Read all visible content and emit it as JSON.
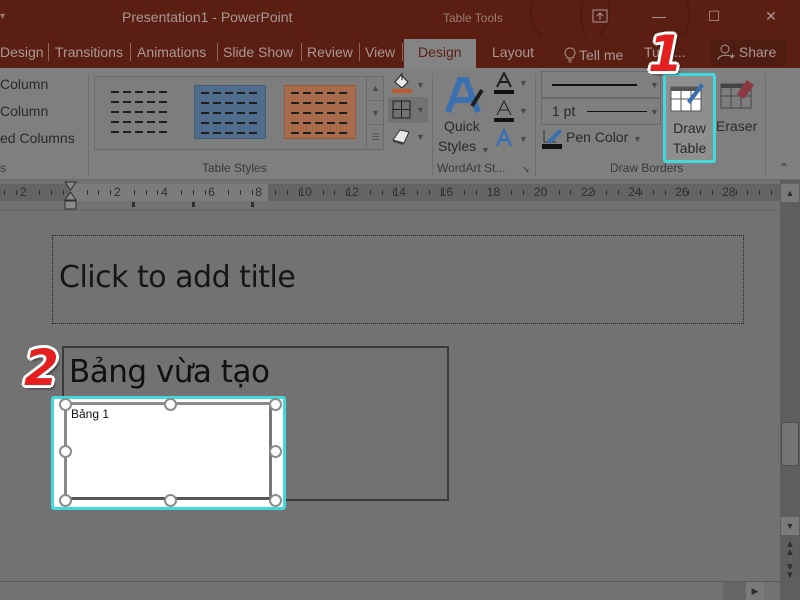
{
  "window": {
    "title": "Presentation1 - PowerPoint",
    "contextual_title": "Table Tools",
    "qat_arrow": "▾",
    "controls": {
      "ribbon_display": "⊼",
      "minimize": "—",
      "maximize": "☐",
      "close": "✕"
    }
  },
  "tabs": [
    {
      "label": "Design",
      "active": false
    },
    {
      "label": "Transitions",
      "active": false
    },
    {
      "label": "Animations",
      "active": false
    },
    {
      "label": "Slide Show",
      "active": false
    },
    {
      "label": "Review",
      "active": false
    },
    {
      "label": "View",
      "active": false
    },
    {
      "label": "Design",
      "active": true,
      "contextual": true
    },
    {
      "label": "Layout",
      "active": false,
      "contextual": true
    }
  ],
  "tell_me": {
    "icon": "lightbulb-icon",
    "label": "Tell me"
  },
  "user_name": "Tu N...",
  "share": {
    "icon": "person-add-icon",
    "label": "Share"
  },
  "ribbon": {
    "table_style_options": {
      "items": [
        "Column",
        "Column",
        "ed Columns"
      ],
      "group_label": "s"
    },
    "table_styles": {
      "group_label": "Table Styles",
      "styles": [
        "No Style, No Grid",
        "Medium Style 2 - Accent 1",
        "Medium Style 2 - Accent 2"
      ],
      "shading_icon": "paint-bucket-icon",
      "borders_icon": "borders-icon",
      "effects_icon": "effects-icon"
    },
    "wordart_styles": {
      "group_label": "WordArt St...",
      "quick_styles_line1": "Quick",
      "quick_styles_line2": "Styles",
      "text_fill_icon": "text-fill-icon",
      "text_outline_icon": "text-outline-icon",
      "text_effects_icon": "text-effects-icon"
    },
    "draw_borders": {
      "group_label": "Draw Borders",
      "pen_weight": "1 pt",
      "pen_color_label": "Pen Color",
      "draw_table_line1": "Draw",
      "draw_table_line2": "Table",
      "eraser_label": "Eraser"
    },
    "collapse_icon": "chevron-up-icon"
  },
  "ruler": {
    "labels": [
      "2",
      "2",
      "4",
      "6",
      "8",
      "10",
      "12",
      "14",
      "16",
      "18",
      "20",
      "22",
      "24",
      "26",
      "28"
    ]
  },
  "slide": {
    "title_placeholder": "Click to add title",
    "content_text": "Bảng vừa tạo",
    "table_cell_text": "Bảng 1"
  },
  "annotations": {
    "step1": "1",
    "step2": "2",
    "highlight_color": "#41d9d9",
    "callout_color": "#e41f1f"
  },
  "colors": {
    "titlebar": "#5a1f12",
    "ribbon": "#7f7f7f",
    "workspace": "#727272"
  }
}
